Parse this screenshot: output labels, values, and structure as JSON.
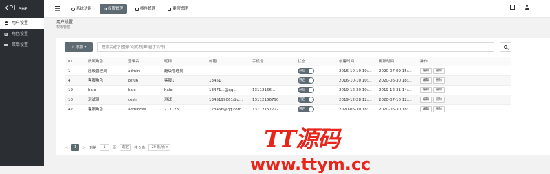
{
  "logo": {
    "main": "KPL",
    "sub": "PHP"
  },
  "sidebar": {
    "items": [
      {
        "label": "用户设置",
        "icon": "user-icon",
        "active": true
      },
      {
        "label": "角色设置",
        "icon": "users-icon",
        "active": false
      },
      {
        "label": "菜单设置",
        "icon": "list-icon",
        "active": false
      }
    ]
  },
  "topbar": {
    "menu_icon": "hamburger-icon",
    "nav": [
      {
        "label": "系统功能",
        "icon": "gear-icon",
        "active": false
      },
      {
        "label": "权限管理",
        "icon": "key-icon",
        "active": true
      },
      {
        "label": "插件管理",
        "icon": "plugin-icon",
        "active": false
      },
      {
        "label": "案例管理",
        "icon": "case-icon",
        "active": false
      }
    ],
    "right_icons": [
      "fullscreen-icon",
      "person-icon"
    ]
  },
  "breadcrumb": {
    "title": "用户设置",
    "subtitle": "权限管理"
  },
  "toolbar": {
    "add_label": "+ 添加 ▾",
    "search_placeholder": "搜索关键字(登录名|昵称|邮箱|手机号)"
  },
  "table": {
    "columns": [
      "ID",
      "所属角色",
      "登录名",
      "昵称",
      "邮箱",
      "手机号",
      "状态",
      "创建时间",
      "更新时间",
      "操作"
    ],
    "rows": [
      {
        "id": "1",
        "role": "超级管理员",
        "login": "admin",
        "nickname": "超级管理员",
        "email": "",
        "phone": "",
        "status": "开启",
        "created": "2016-10-10 10:...",
        "updated": "2020-07-09 15:...",
        "edit": "编辑",
        "delete": "删除"
      },
      {
        "id": "4",
        "role": "客服角色",
        "login": "kefu6",
        "nickname": "客服1",
        "email": "13451",
        "phone": "",
        "status": "开启",
        "created": "2016-10-10 10:...",
        "updated": "2020-06-30 18:...",
        "edit": "编辑",
        "delete": "删除"
      },
      {
        "id": "19",
        "role": "halo",
        "login": "halo",
        "nickname": "halo",
        "email": "13471...@qq...",
        "phone": "13112156...",
        "status": "开启",
        "created": "2019-12-30 10:...",
        "updated": "2019-12-31 14:...",
        "edit": "编辑",
        "delete": "删除"
      },
      {
        "id": "10",
        "role": "测试组",
        "login": "ceshi",
        "nickname": "测试",
        "email": "1345199061@q...",
        "phone": "13112156790",
        "status": "开启",
        "created": "2019-12-28 12:...",
        "updated": "2020-07-10 12:...",
        "edit": "编辑",
        "delete": "删除"
      },
      {
        "id": "42",
        "role": "客服角色",
        "login": "adminces...",
        "nickname": "213123",
        "email": "123456@qq.com",
        "phone": "13112157722",
        "status": "开启",
        "created": "2020-06-30 18:...",
        "updated": "2020-06-30 18:...",
        "edit": "编辑",
        "delete": "删除"
      }
    ]
  },
  "pagination": {
    "prev": "<",
    "current": "1",
    "next": ">",
    "goto_label": "到第",
    "goto_value": "1",
    "page_unit": "页",
    "confirm": "确定",
    "total": "共 5 条",
    "page_size": "20 条/页 ▾"
  },
  "watermark": {
    "line1": "TT源码",
    "line2": "www.ttym.cc"
  },
  "colors": {
    "sidebar_bg": "#2b2f33",
    "accent": "#5f6b73",
    "watermark": "#e8251a"
  }
}
